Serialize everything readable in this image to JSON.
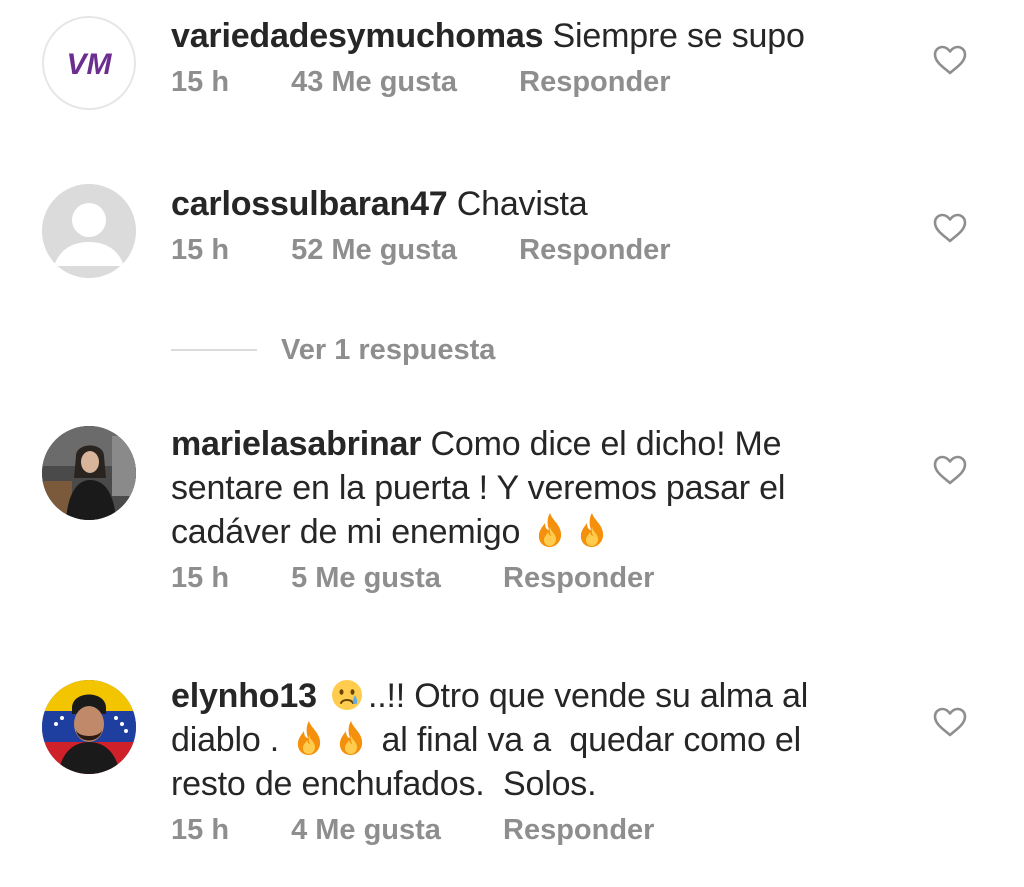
{
  "comments": [
    {
      "username": "variedadesymuchomas",
      "text": "Siempre se supo",
      "time": "15 h",
      "likes": "43 Me gusta",
      "reply_label": "Responder",
      "avatar_text": "VM",
      "avatar_color": "#6b2d8f"
    },
    {
      "username": "carlossulbaran47",
      "text": "Chavista",
      "time": "15 h",
      "likes": "52 Me gusta",
      "reply_label": "Responder",
      "view_replies": "Ver 1 respuesta"
    },
    {
      "username": "marielasabrinar",
      "text_part1": "Como dice el dicho! Me sentare en la puerta ! Y veremos pasar el cadáver de mi enemigo",
      "time": "15 h",
      "likes": "5 Me gusta",
      "reply_label": "Responder"
    },
    {
      "username": "elynho13",
      "text_part1": "..!! Otro que vende su alma al diablo .",
      "text_part2": "al final va a  quedar como el resto de enchufados.  Solos.",
      "time": "15 h",
      "likes": "4 Me gusta",
      "reply_label": "Responder"
    }
  ],
  "colors": {
    "text": "#262626",
    "meta": "#8e8e8e",
    "divider": "#dbdbdb"
  },
  "icons": [
    "heart-outline-icon",
    "fire-emoji-icon",
    "crying-face-emoji-icon"
  ]
}
